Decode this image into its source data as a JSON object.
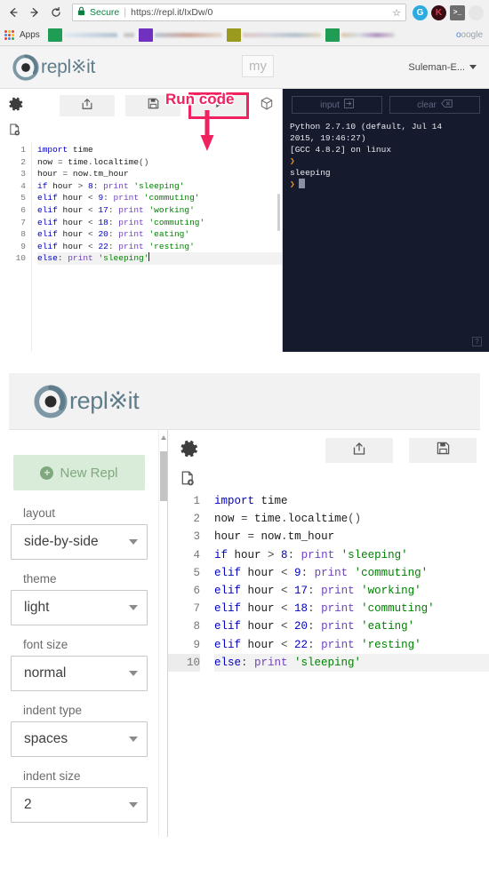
{
  "browser": {
    "back_icon": "back-arrow-icon",
    "forward_icon": "forward-arrow-icon",
    "reload_icon": "reload-icon",
    "security_label": "Secure",
    "url": "https://repl.it/IxDw/0",
    "url_domain": "https://repl.it",
    "url_path": "/IxDw/0",
    "star_glyph": "☆",
    "apps_label": "Apps",
    "bookmark_tail_text": "oogle",
    "bookmark_tail_prefix": "o",
    "extensions": [
      "grammarly-extension-icon",
      "kami-extension-icon",
      "terminal-extension-icon",
      "faded-extension-icon"
    ]
  },
  "app": {
    "logo_text": "repl",
    "logo_comma": "※",
    "logo_suffix": "it",
    "my_badge": "my",
    "user_name": "Suleman-E...",
    "annotation": "Run code"
  },
  "toolbar": {
    "gear_icon": "gear-icon",
    "share_icon": "share-icon",
    "save_icon": "save-icon",
    "run_icon": "play-icon",
    "package_icon": "package-cube-icon",
    "new_file_icon": "new-file-icon"
  },
  "console": {
    "input_label": "input",
    "input_icon": "enter-box-icon",
    "clear_label": "clear",
    "clear_icon": "backspace-icon",
    "help_label": "?",
    "lines": [
      "Python 2.7.10 (default, Jul 14",
      "2015, 19:46:27)",
      "[GCC 4.8.2] on linux"
    ],
    "prompt_glyph": "❯",
    "output": "sleeping",
    "colors": {
      "background": "#151b2c",
      "text": "#e8eaf0",
      "prompt": "#f0912d"
    }
  },
  "editor": {
    "active_line": 10,
    "lines": [
      {
        "n": 1,
        "tokens": [
          {
            "t": "import ",
            "c": "kw"
          },
          {
            "t": "time",
            "c": "pl"
          }
        ]
      },
      {
        "n": 2,
        "tokens": [
          {
            "t": "now ",
            "c": "pl"
          },
          {
            "t": "= ",
            "c": "op"
          },
          {
            "t": "time",
            "c": "pl"
          },
          {
            "t": ".",
            "c": "op"
          },
          {
            "t": "localtime",
            "c": "pl"
          },
          {
            "t": "()",
            "c": "op"
          }
        ]
      },
      {
        "n": 3,
        "tokens": [
          {
            "t": "hour ",
            "c": "pl"
          },
          {
            "t": "= ",
            "c": "op"
          },
          {
            "t": "now",
            "c": "pl"
          },
          {
            "t": ".",
            "c": "op"
          },
          {
            "t": "tm_hour",
            "c": "pl"
          }
        ]
      },
      {
        "n": 4,
        "tokens": [
          {
            "t": "if ",
            "c": "kw"
          },
          {
            "t": "hour ",
            "c": "pl"
          },
          {
            "t": "> ",
            "c": "op"
          },
          {
            "t": "8",
            "c": "num"
          },
          {
            "t": ": ",
            "c": "op"
          },
          {
            "t": "print ",
            "c": "bi"
          },
          {
            "t": "'sleeping'",
            "c": "str"
          }
        ]
      },
      {
        "n": 5,
        "tokens": [
          {
            "t": "elif ",
            "c": "kw"
          },
          {
            "t": "hour ",
            "c": "pl"
          },
          {
            "t": "< ",
            "c": "op"
          },
          {
            "t": "9",
            "c": "num"
          },
          {
            "t": ": ",
            "c": "op"
          },
          {
            "t": "print ",
            "c": "bi"
          },
          {
            "t": "'commuting'",
            "c": "str"
          }
        ]
      },
      {
        "n": 6,
        "tokens": [
          {
            "t": "elif ",
            "c": "kw"
          },
          {
            "t": "hour ",
            "c": "pl"
          },
          {
            "t": "< ",
            "c": "op"
          },
          {
            "t": "17",
            "c": "num"
          },
          {
            "t": ": ",
            "c": "op"
          },
          {
            "t": "print ",
            "c": "bi"
          },
          {
            "t": "'working'",
            "c": "str"
          }
        ]
      },
      {
        "n": 7,
        "tokens": [
          {
            "t": "elif ",
            "c": "kw"
          },
          {
            "t": "hour ",
            "c": "pl"
          },
          {
            "t": "< ",
            "c": "op"
          },
          {
            "t": "18",
            "c": "num"
          },
          {
            "t": ": ",
            "c": "op"
          },
          {
            "t": "print ",
            "c": "bi"
          },
          {
            "t": "'commuting'",
            "c": "str"
          }
        ]
      },
      {
        "n": 8,
        "tokens": [
          {
            "t": "elif ",
            "c": "kw"
          },
          {
            "t": "hour ",
            "c": "pl"
          },
          {
            "t": "< ",
            "c": "op"
          },
          {
            "t": "20",
            "c": "num"
          },
          {
            "t": ": ",
            "c": "op"
          },
          {
            "t": "print ",
            "c": "bi"
          },
          {
            "t": "'eating'",
            "c": "str"
          }
        ]
      },
      {
        "n": 9,
        "tokens": [
          {
            "t": "elif ",
            "c": "kw"
          },
          {
            "t": "hour ",
            "c": "pl"
          },
          {
            "t": "< ",
            "c": "op"
          },
          {
            "t": "22",
            "c": "num"
          },
          {
            "t": ": ",
            "c": "op"
          },
          {
            "t": "print ",
            "c": "bi"
          },
          {
            "t": "'resting'",
            "c": "str"
          }
        ]
      },
      {
        "n": 10,
        "tokens": [
          {
            "t": "else",
            "c": "kw"
          },
          {
            "t": ": ",
            "c": "op"
          },
          {
            "t": "print ",
            "c": "bi"
          },
          {
            "t": "'sleeping'",
            "c": "str"
          }
        ]
      }
    ]
  },
  "settings": {
    "new_repl_label": "New Repl",
    "new_repl_icon": "plus-circle-icon",
    "fields": [
      {
        "label": "layout",
        "value": "side-by-side"
      },
      {
        "label": "theme",
        "value": "light"
      },
      {
        "label": "font size",
        "value": "normal"
      },
      {
        "label": "indent type",
        "value": "spaces"
      },
      {
        "label": "indent size",
        "value": "2"
      }
    ]
  }
}
